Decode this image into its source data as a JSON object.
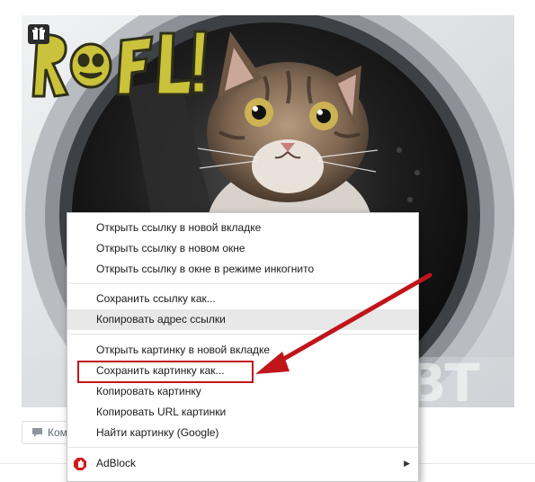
{
  "image": {
    "watermark_logo": "ROFL!",
    "watermark_corner": "BT"
  },
  "comment_button": {
    "label": "Ком"
  },
  "context_menu": {
    "items": [
      {
        "label": "Открыть ссылку в новой вкладке"
      },
      {
        "label": "Открыть ссылку в новом окне"
      },
      {
        "label": "Открыть ссылку в окне в режиме инкогнито"
      },
      {
        "label": "Сохранить ссылку как..."
      },
      {
        "label": "Копировать адрес ссылки"
      },
      {
        "label": "Открыть картинку в новой вкладке"
      },
      {
        "label": "Сохранить картинку как..."
      },
      {
        "label": "Копировать картинку"
      },
      {
        "label": "Копировать URL картинки"
      },
      {
        "label": "Найти картинку (Google)"
      },
      {
        "label": "AdBlock"
      }
    ],
    "hovered_item": "Копировать адрес ссылки",
    "annotated_item": "Сохранить картинку как..."
  },
  "colors": {
    "annotation": "#c0151a",
    "adblock": "#d01c1c",
    "hover": "#e8e8e8"
  },
  "icons": {
    "gift": "gift-icon",
    "comment": "speech-bubble-icon",
    "adblock": "adblock-hand-icon",
    "submenu": "triangle-right-icon"
  }
}
